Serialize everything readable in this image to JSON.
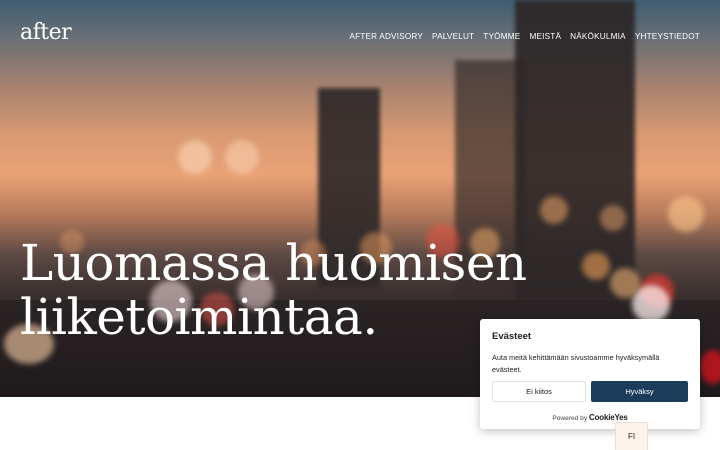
{
  "brand": {
    "logo": "after"
  },
  "nav": {
    "items": [
      {
        "label": "AFTER ADVISORY"
      },
      {
        "label": "PALVELUT"
      },
      {
        "label": "TYÖMME"
      },
      {
        "label": "MEISTÄ"
      },
      {
        "label": "NÄKÖKULMIA"
      },
      {
        "label": "YHTEYSTIEDOT"
      }
    ]
  },
  "hero": {
    "headline_line1": "Luomassa huomisen",
    "headline_line2": "liiketoimintaa."
  },
  "cookie_banner": {
    "title": "Evästeet",
    "text": "Auta meitä kehittämään sivustoamme hyväksymällä evästeet.",
    "decline_label": "Ei kiitos",
    "accept_label": "Hyväksy",
    "powered_by": "Powered by",
    "powered_brand": "CookieYes",
    "accent_color": "#1c3d5a"
  },
  "language": {
    "current": "FI"
  }
}
